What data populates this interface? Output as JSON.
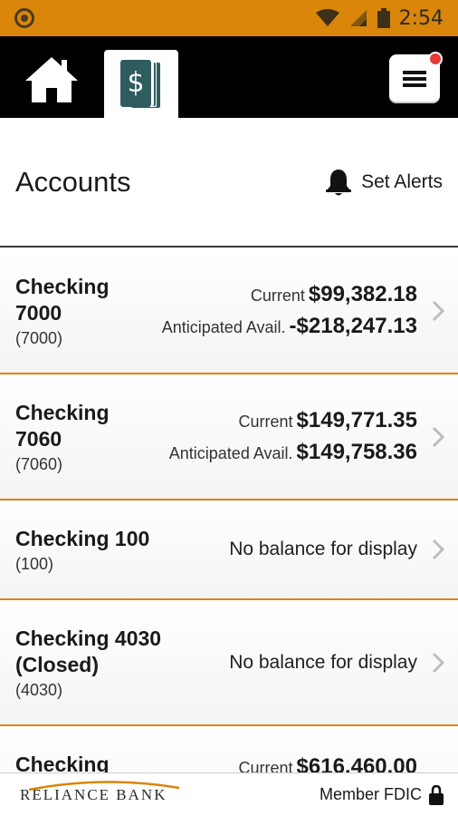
{
  "status_bar": {
    "time": "2:54"
  },
  "nav": {
    "home_icon": "home-icon",
    "accounts_icon": "dollar-bills-icon",
    "menu_icon": "hamburger-menu-icon",
    "badge_color": "#e53935"
  },
  "header": {
    "title": "Accounts",
    "alerts_label": "Set Alerts"
  },
  "accounts": [
    {
      "name_line1": "Checking",
      "name_line2": "7000",
      "number": "(7000)",
      "current_label": "Current",
      "current_amount": "$99,382.18",
      "anticipated_label": "Anticipated Avail.",
      "anticipated_amount": "-$218,247.13"
    },
    {
      "name_line1": "Checking",
      "name_line2": "7060",
      "number": "(7060)",
      "current_label": "Current",
      "current_amount": "$149,771.35",
      "anticipated_label": "Anticipated Avail.",
      "anticipated_amount": "$149,758.36"
    },
    {
      "name_line1": "Checking 100",
      "number": "(100)",
      "balance_text": "No balance for display"
    },
    {
      "name_line1": "Checking 4030",
      "name_line2": "(Closed)",
      "number": "(4030)",
      "balance_text": "No balance for display"
    },
    {
      "name_line1": "Checking",
      "current_label": "Current",
      "current_amount": "$616,460.00"
    }
  ],
  "footer": {
    "logo_text": "RELIANCE BANK",
    "fdic_label": "Member FDIC"
  },
  "colors": {
    "accent": "#d9860a",
    "nav_bg": "#000000",
    "icon_teal": "#2e5c5f"
  }
}
